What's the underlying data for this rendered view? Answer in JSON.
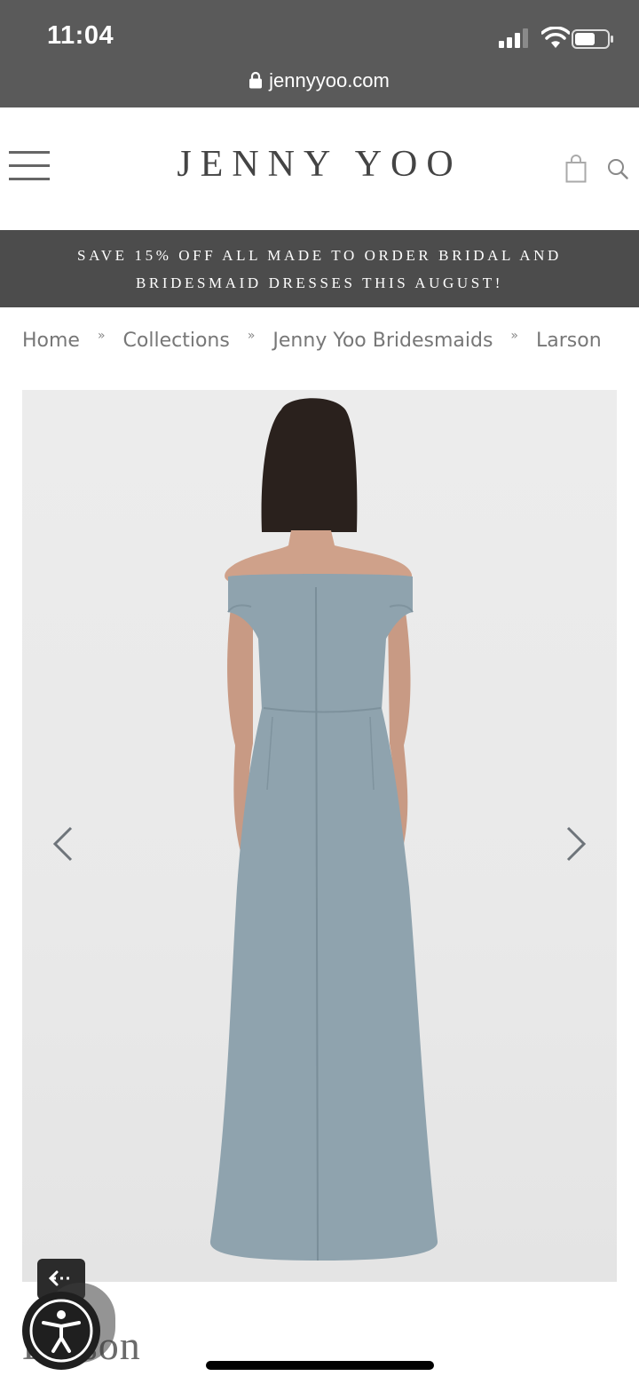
{
  "status_bar": {
    "time": "11:04"
  },
  "address_bar": {
    "url": "jennyyoo.com"
  },
  "header": {
    "brand": "JENNY YOO"
  },
  "promo": {
    "line1": "SAVE 15% OFF ALL MADE TO ORDER BRIDAL AND",
    "line2": "BRIDESMAID DRESSES THIS AUGUST!"
  },
  "breadcrumb": {
    "items": [
      "Home",
      "Collections",
      "Jenny Yoo Bridesmaids",
      "Larson"
    ],
    "separator": "»"
  },
  "product": {
    "title": "Larson",
    "dress_color": "#8fa3ae",
    "image_bg": "#ebebeb"
  },
  "colors": {
    "status_bar_bg": "#5a5a5a",
    "promo_bg": "#4c4c4c",
    "text_gray": "#777777"
  },
  "icons": [
    "signal-icon",
    "wifi-icon",
    "battery-icon",
    "lock-icon",
    "menu-icon",
    "shopping-bag-icon",
    "search-icon",
    "chevron-left-icon",
    "chevron-right-icon",
    "back-arrow-icon",
    "accessibility-icon"
  ]
}
